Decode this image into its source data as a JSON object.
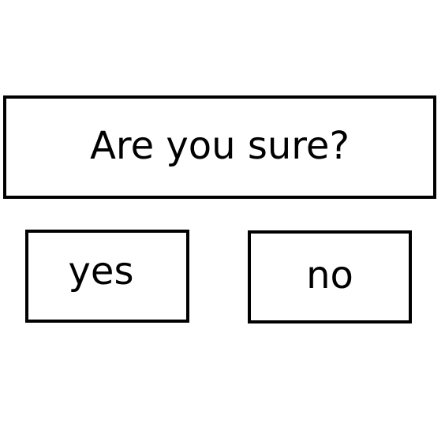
{
  "dialog": {
    "question": "Are you sure?",
    "yes_label": "yes",
    "no_label": "no"
  },
  "colors": {
    "background": "#ffffff",
    "border": "#000000",
    "text": "#000000"
  }
}
